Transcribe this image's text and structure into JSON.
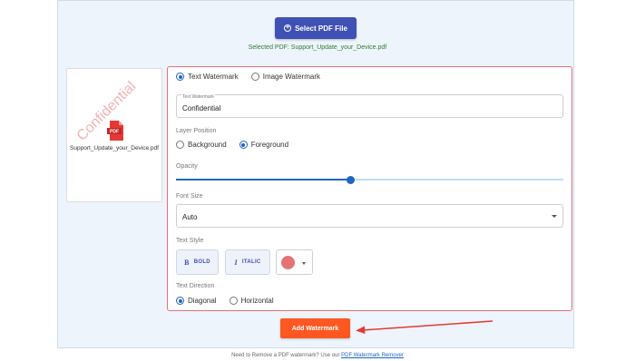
{
  "upload": {
    "select_button_label": "Select PDF File",
    "selected_file_text": "Selected PDF: Support_Update_your_Device.pdf"
  },
  "preview": {
    "filename": "Support_Update_your_Device.pdf",
    "pdf_badge": "PDF",
    "watermark_text": "Confidential"
  },
  "watermark_type": {
    "options": [
      "Text Watermark",
      "Image Watermark"
    ],
    "selected": "Text Watermark"
  },
  "text_watermark_field": {
    "label": "Text Watermark",
    "value": "Confidential"
  },
  "layer_position": {
    "label": "Layer Position",
    "options": [
      "Background",
      "Foreground"
    ],
    "selected": "Foreground"
  },
  "opacity": {
    "label": "Opacity",
    "value_fraction": 0.45
  },
  "font_size": {
    "label": "Font Size",
    "value": "Auto"
  },
  "text_style": {
    "label": "Text Style",
    "bold_label": "BOLD",
    "italic_label": "ITALIC",
    "color": "#e57373"
  },
  "text_direction": {
    "label": "Text Direction",
    "options": [
      "Diagonal",
      "Horizontal"
    ],
    "selected": "Diagonal"
  },
  "action": {
    "add_button_label": "Add Watermark"
  },
  "footer": {
    "text": "Need to Remove a PDF watermark? Use our",
    "link_text": "PDF Watermark Remover"
  },
  "colors": {
    "primary": "#3f51b5",
    "accent": "#ff5722",
    "selection_blue": "#1e66c2",
    "success_green": "#2e7d32",
    "highlight_red": "#e57373"
  }
}
